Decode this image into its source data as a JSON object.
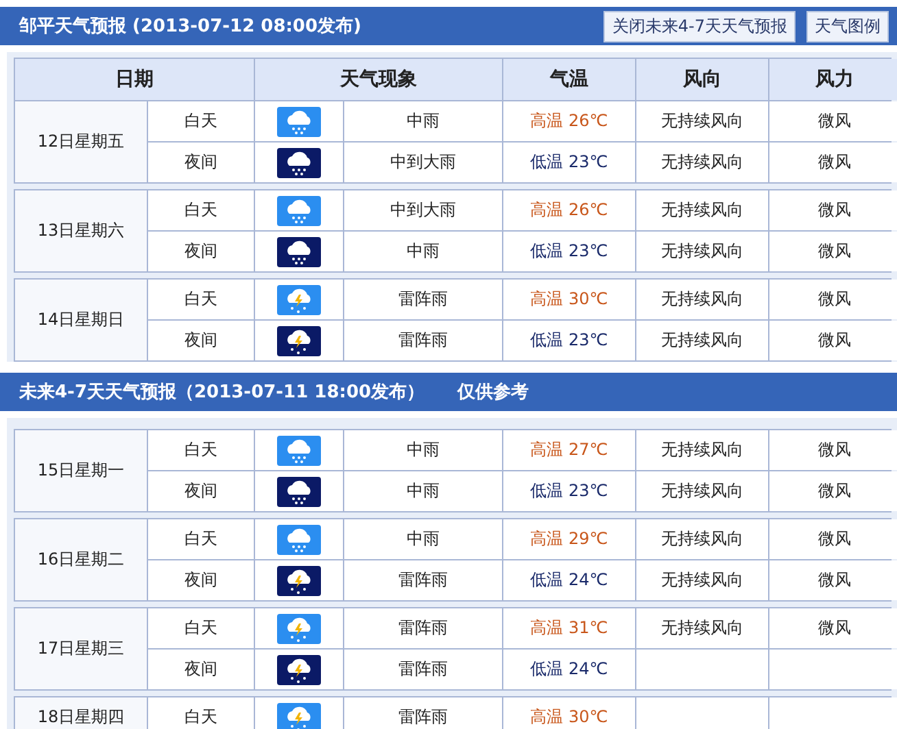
{
  "sections": [
    {
      "title": "邹平天气预报 (2013-07-12  08:00发布)",
      "buttons": [
        "关闭未来4-7天天气预报",
        "天气图例"
      ],
      "columns": [
        "日期",
        "天气现象",
        "气温",
        "风向",
        "风力"
      ],
      "days": [
        {
          "date": "12日星期五",
          "periods": [
            {
              "label": "白天",
              "night": false,
              "icon": {
                "kind": "rain"
              },
              "weather": "中雨",
              "temp": "高温 26℃",
              "wind_dir": "无持续风向",
              "wind_force": "微风"
            },
            {
              "label": "夜间",
              "night": true,
              "icon": {
                "kind": "rain"
              },
              "weather": "中到大雨",
              "temp": "低温 23℃",
              "wind_dir": "无持续风向",
              "wind_force": "微风"
            }
          ]
        },
        {
          "date": "13日星期六",
          "periods": [
            {
              "label": "白天",
              "night": false,
              "icon": {
                "kind": "rain"
              },
              "weather": "中到大雨",
              "temp": "高温 26℃",
              "wind_dir": "无持续风向",
              "wind_force": "微风"
            },
            {
              "label": "夜间",
              "night": true,
              "icon": {
                "kind": "rain"
              },
              "weather": "中雨",
              "temp": "低温 23℃",
              "wind_dir": "无持续风向",
              "wind_force": "微风"
            }
          ]
        },
        {
          "date": "14日星期日",
          "periods": [
            {
              "label": "白天",
              "night": false,
              "icon": {
                "kind": "thunder"
              },
              "weather": "雷阵雨",
              "temp": "高温 30℃",
              "wind_dir": "无持续风向",
              "wind_force": "微风"
            },
            {
              "label": "夜间",
              "night": true,
              "icon": {
                "kind": "thunder"
              },
              "weather": "雷阵雨",
              "temp": "低温 23℃",
              "wind_dir": "无持续风向",
              "wind_force": "微风"
            }
          ]
        }
      ]
    },
    {
      "title": "未来4-7天天气预报（2013-07-11 18:00发布）",
      "note": "仅供参考",
      "days": [
        {
          "date": "15日星期一",
          "periods": [
            {
              "label": "白天",
              "night": false,
              "icon": {
                "kind": "rain"
              },
              "weather": "中雨",
              "temp": "高温 27℃",
              "wind_dir": "无持续风向",
              "wind_force": "微风"
            },
            {
              "label": "夜间",
              "night": true,
              "icon": {
                "kind": "rain"
              },
              "weather": "中雨",
              "temp": "低温 23℃",
              "wind_dir": "无持续风向",
              "wind_force": "微风"
            }
          ]
        },
        {
          "date": "16日星期二",
          "periods": [
            {
              "label": "白天",
              "night": false,
              "icon": {
                "kind": "rain"
              },
              "weather": "中雨",
              "temp": "高温 29℃",
              "wind_dir": "无持续风向",
              "wind_force": "微风"
            },
            {
              "label": "夜间",
              "night": true,
              "icon": {
                "kind": "thunder"
              },
              "weather": "雷阵雨",
              "temp": "低温 24℃",
              "wind_dir": "无持续风向",
              "wind_force": "微风"
            }
          ]
        },
        {
          "date": "17日星期三",
          "periods": [
            {
              "label": "白天",
              "night": false,
              "icon": {
                "kind": "thunder"
              },
              "weather": "雷阵雨",
              "temp": "高温 31℃",
              "wind_dir": "无持续风向",
              "wind_force": "微风"
            },
            {
              "label": "夜间",
              "night": true,
              "icon": {
                "kind": "thunder"
              },
              "weather": "雷阵雨",
              "temp": "低温 24℃"
            }
          ]
        },
        {
          "date": "18日星期四",
          "periods": [
            {
              "label": "白天",
              "night": false,
              "icon": {
                "kind": "thunder"
              },
              "weather": "雷阵雨",
              "temp": "高温 30℃"
            }
          ]
        }
      ]
    }
  ]
}
